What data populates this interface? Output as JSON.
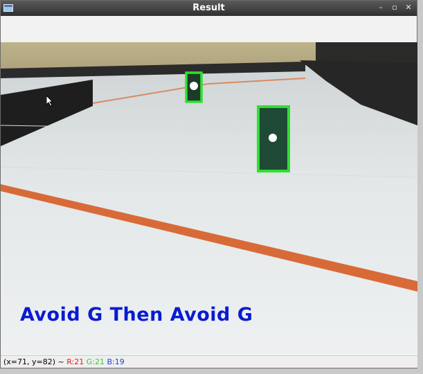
{
  "window": {
    "title": "Result",
    "controls": {
      "minimize": "–",
      "maximize": "▫",
      "close": "✕"
    }
  },
  "overlay": {
    "message": "Avoid G Then Avoid G"
  },
  "status": {
    "coords": "(x=71, y=82) ~",
    "r": "R:21",
    "g": "G:21",
    "b": "B:19"
  },
  "colors": {
    "detection_box": "#2ee02e",
    "overlay_text": "#0a1bd0",
    "lane_line": "#d86a38"
  },
  "icons": [
    "app-window-icon",
    "mouse-cursor-icon"
  ]
}
